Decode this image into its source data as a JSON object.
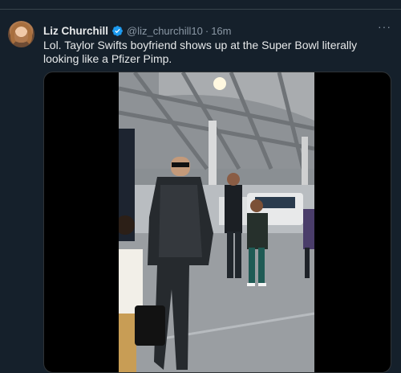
{
  "tweet": {
    "author_name": "Liz Churchill",
    "handle": "@liz_churchill10",
    "separator": "·",
    "time": "16m",
    "more_label": "···",
    "text": "Lol. Taylor Swifts boyfriend shows up at the Super Bowl literally looking like a Pfizer Pimp.",
    "icons": {
      "verified": "verified-badge-icon",
      "more": "more-options-icon"
    }
  },
  "colors": {
    "background": "#15202b",
    "text_primary": "#e7e9ea",
    "text_secondary": "#8b98a5",
    "verified": "#1d9bf0",
    "media_letterbox": "#000000"
  },
  "media": {
    "type": "video-still",
    "alt": "Man in black sequined outfit and sunglasses walking through a stadium tunnel"
  }
}
